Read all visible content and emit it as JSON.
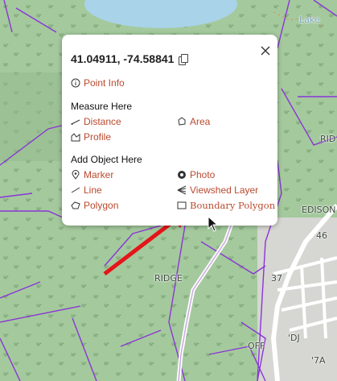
{
  "popup": {
    "coordinates": "41.04911, -74.58841",
    "point_info": "Point Info",
    "measure_heading": "Measure Here",
    "measure": {
      "distance": "Distance",
      "area": "Area",
      "profile": "Profile"
    },
    "add_heading": "Add Object Here",
    "add": {
      "marker": "Marker",
      "photo": "Photo",
      "line": "Line",
      "viewshed": "Viewshed Layer",
      "polygon": "Polygon",
      "boundary_polygon": "Boundary Polygon"
    }
  },
  "map_labels": {
    "ridge_center": "RIDGE",
    "ridge_right": "RID",
    "edison": "EDISON",
    "route_46": "46",
    "route_37": "37",
    "dj": "'DJ",
    "off": "OFF",
    "seven_a": "'7A",
    "lake": "Lake"
  },
  "colors": {
    "link": "#b94a2e",
    "boundary": "#8a35d6",
    "forest": "#9fc49a",
    "water": "#a9d3e8",
    "arrow": "#e5151a"
  }
}
